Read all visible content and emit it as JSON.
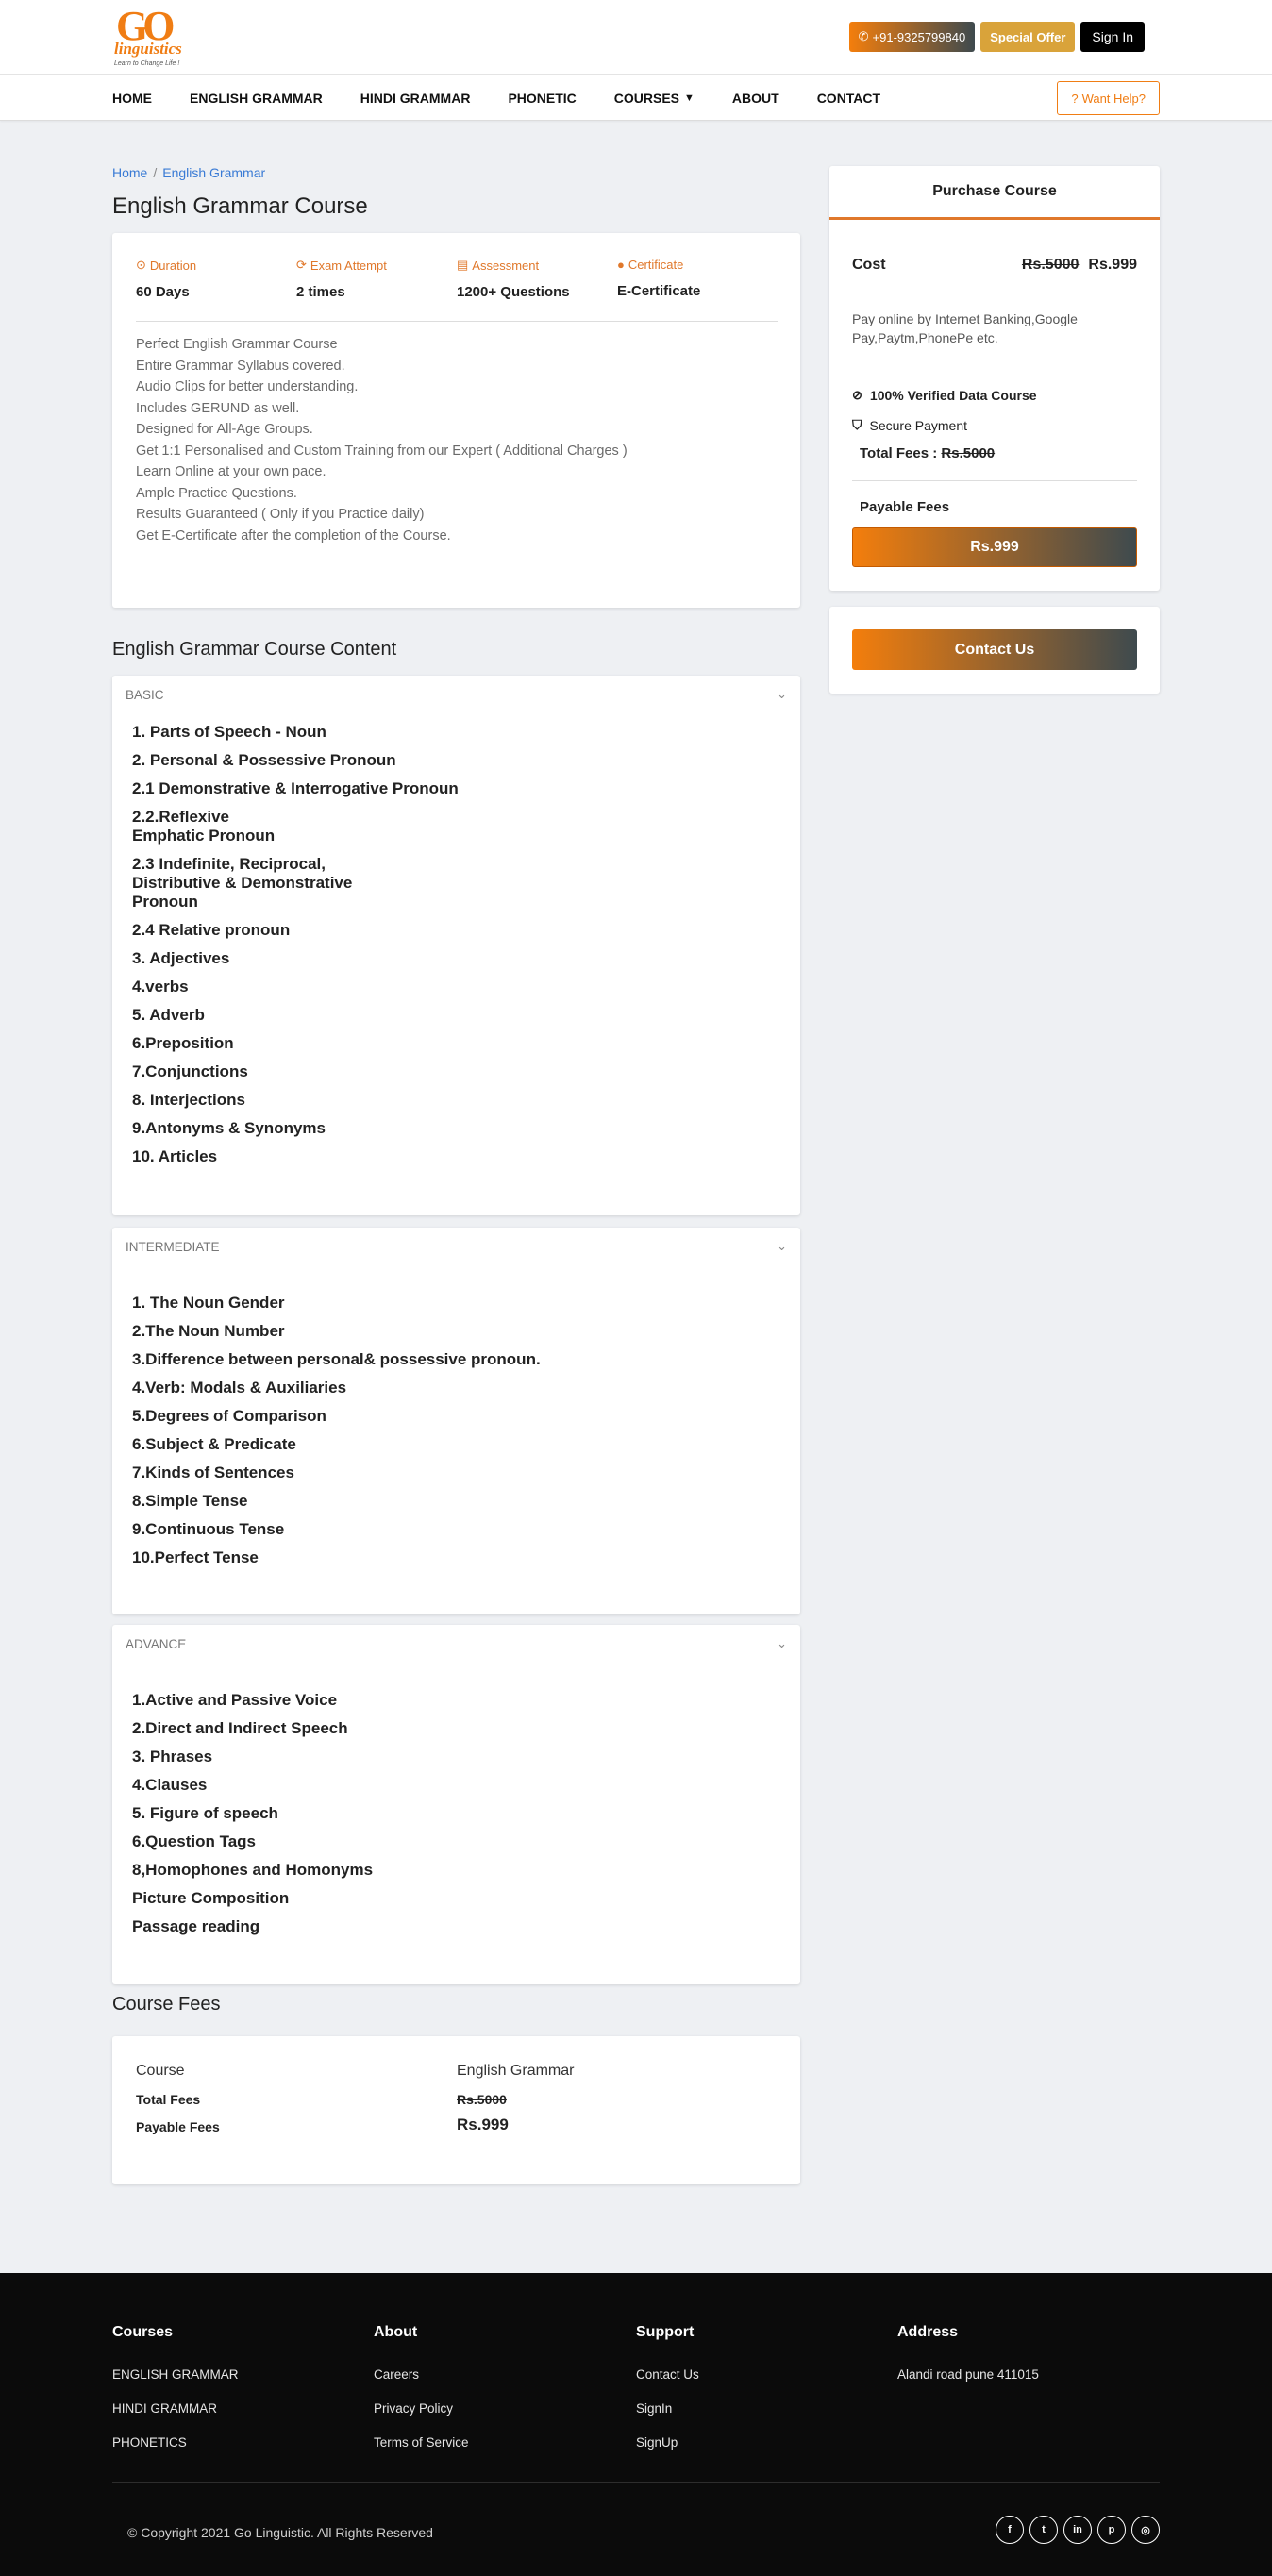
{
  "brand": {
    "mark": "GO",
    "name": "linguistics",
    "tagline": "Learn to Change Life !"
  },
  "topbar": {
    "phone": "+91-9325799840",
    "offer": "Special Offer",
    "signin": "Sign In"
  },
  "nav": {
    "items": [
      {
        "label": "HOME"
      },
      {
        "label": "ENGLISH GRAMMAR"
      },
      {
        "label": "HINDI GRAMMAR"
      },
      {
        "label": "PHONETIC"
      },
      {
        "label": "COURSES"
      },
      {
        "label": "ABOUT"
      },
      {
        "label": "CONTACT"
      }
    ],
    "help": "Want Help?"
  },
  "breadcrumb": {
    "home": "Home",
    "sep": "/",
    "current": "English Grammar"
  },
  "page_title": "English Grammar Course",
  "stats": [
    {
      "label": "Duration",
      "value": "60 Days",
      "icon": "clock-icon"
    },
    {
      "label": "Exam Attempt",
      "value": "2 times",
      "icon": "refresh-icon"
    },
    {
      "label": "Assessment",
      "value": "1200+ Questions",
      "icon": "file-icon"
    },
    {
      "label": "Certificate",
      "value": "E-Certificate",
      "icon": "circle-icon"
    }
  ],
  "features": [
    "Perfect English Grammar Course",
    "Entire Grammar Syllabus covered.",
    "Audio Clips for better understanding.",
    "Includes GERUND as well.",
    "Designed for All-Age Groups.",
    "Get 1:1 Personalised and Custom Training from our Expert ( Additional Charges )",
    "Learn Online at your own pace.",
    "Ample Practice Questions.",
    "Results Guaranteed ( Only if you Practice daily)",
    "Get E-Certificate after the completion of the Course."
  ],
  "content_title": "English Grammar Course Content",
  "basic": {
    "title": "BASIC",
    "items": [
      "1. Parts of Speech - Noun",
      "2. Personal & Possessive Pronoun",
      "2.1 Demonstrative & Interrogative Pronoun",
      "2.2.Reflexive Emphatic Pronoun",
      "2.3 Indefinite, Reciprocal, Distributive & Demonstrative Pronoun",
      "2.4 Relative pronoun",
      "3. Adjectives",
      "4.verbs",
      "5. Adverb",
      "6.Preposition",
      "7.Conjunctions",
      "8. Interjections",
      "9.Antonyms & Synonyms",
      "10. Articles"
    ]
  },
  "intermediate": {
    "title": "INTERMEDIATE",
    "items": [
      "1. The Noun Gender",
      "2.The Noun Number",
      "3.Difference between personal& possessive pronoun.",
      "4.Verb: Modals & Auxiliaries",
      "5.Degrees of Comparison",
      "6.Subject & Predicate",
      "7.Kinds of Sentences",
      "8.Simple Tense",
      "9.Continuous Tense",
      "10.Perfect Tense"
    ]
  },
  "advance": {
    "title": "ADVANCE",
    "items": [
      "1.Active and Passive Voice",
      "2.Direct and Indirect Speech",
      "3. Phrases",
      "4.Clauses",
      "5. Figure of speech",
      "6.Question Tags",
      "8,Homophones and Homonyms",
      "Picture Composition",
      "Passage reading"
    ]
  },
  "fees": {
    "title": "Course Fees",
    "course_label": "Course",
    "course_value": "English Grammar",
    "total_label": "Total Fees",
    "total_value": "Rs.5000",
    "payable_label": "Payable Fees",
    "payable_value": "Rs.999"
  },
  "purchase": {
    "title": "Purchase Course",
    "cost_label": "Cost",
    "old_price": "Rs.5000",
    "new_price": "Rs.999",
    "pay_note": "Pay online by Internet Banking,Google Pay,Paytm,PhonePe etc.",
    "verified": "100% Verified Data Course",
    "secure": "Secure Payment",
    "total_prefix": "Total Fees :",
    "total_value": "Rs.5000",
    "payable_label": "Payable Fees",
    "pay_button": "Rs.999"
  },
  "contact_button": "Contact Us",
  "footer": {
    "courses": {
      "title": "Courses",
      "links": [
        "ENGLISH GRAMMAR",
        "HINDI GRAMMAR",
        "PHONETICS"
      ]
    },
    "about": {
      "title": "About",
      "links": [
        "Careers",
        "Privacy Policy",
        "Terms of Service"
      ]
    },
    "support": {
      "title": "Support",
      "links": [
        "Contact Us",
        "SignIn",
        "SignUp"
      ]
    },
    "address": {
      "title": "Address",
      "text": "Alandi road pune 411015"
    },
    "copyright": "© Copyright 2021 Go Linguistic. All Rights Reserved",
    "socials": [
      {
        "glyph": "f",
        "icon": "facebook-icon"
      },
      {
        "glyph": "t",
        "icon": "twitter-icon"
      },
      {
        "glyph": "in",
        "icon": "linkedin-icon"
      },
      {
        "glyph": "p",
        "icon": "pinterest-icon"
      },
      {
        "glyph": "◎",
        "icon": "instagram-icon"
      }
    ]
  },
  "colors": {
    "accent": "#f07d14",
    "gradient_end": "#3e4a4e",
    "link": "#3a7bd5",
    "offer": "#d9a33a",
    "footer": "#0b0b0b"
  }
}
